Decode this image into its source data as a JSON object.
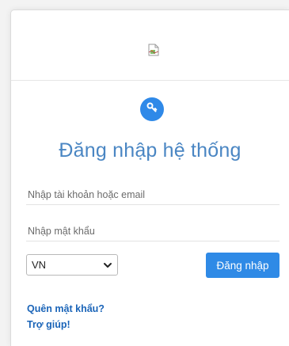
{
  "login": {
    "title": "Đăng nhập hệ thống",
    "username_placeholder": "Nhập tài khoản hoặc email",
    "password_placeholder": "Nhập mật khẩu",
    "language_value": "VN",
    "login_button": "Đăng nhập",
    "forgot_link": "Quên mật khẩu?",
    "help_link": "Trợ giúp!"
  },
  "icons": {
    "header_image": "broken-image-icon",
    "badge": "key-icon",
    "select_arrow": "chevron-down-icon"
  },
  "colors": {
    "accent": "#2f8ae6",
    "title": "#4a86c3",
    "link": "#1a64b8"
  }
}
